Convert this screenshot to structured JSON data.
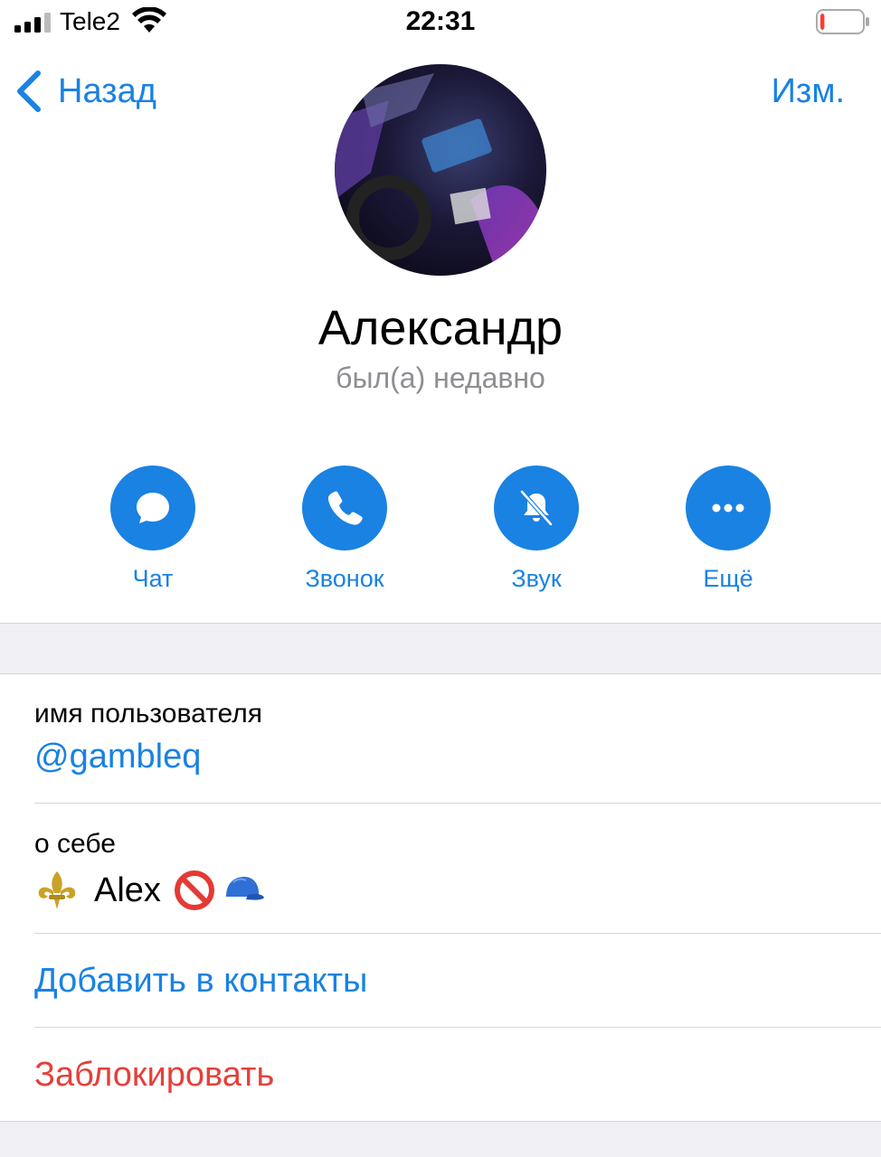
{
  "status_bar": {
    "carrier": "Tele2",
    "time": "22:31",
    "battery_level": 0.1
  },
  "nav": {
    "back_label": "Назад",
    "edit_label": "Изм."
  },
  "profile": {
    "name": "Александр",
    "last_seen": "был(а) недавно"
  },
  "actions": [
    {
      "label": "Чат",
      "icon": "chat-bubble-icon"
    },
    {
      "label": "Звонок",
      "icon": "phone-icon"
    },
    {
      "label": "Звук",
      "icon": "bell-muted-icon"
    },
    {
      "label": "Ещё",
      "icon": "more-dots-icon"
    }
  ],
  "info": {
    "username_label": "имя пользователя",
    "username_value": "@gambleq",
    "about_label": "о себе",
    "about_text": "Alex",
    "about_emojis": [
      "fleur-de-lis-emoji",
      "prohibited-emoji",
      "cap-emoji"
    ],
    "add_contact": "Добавить в контакты",
    "block": "Заблокировать"
  },
  "colors": {
    "accent": "#1a82e2",
    "danger": "#e5403a",
    "secondary_text": "#8e8e93",
    "background_gray": "#efeff4"
  }
}
